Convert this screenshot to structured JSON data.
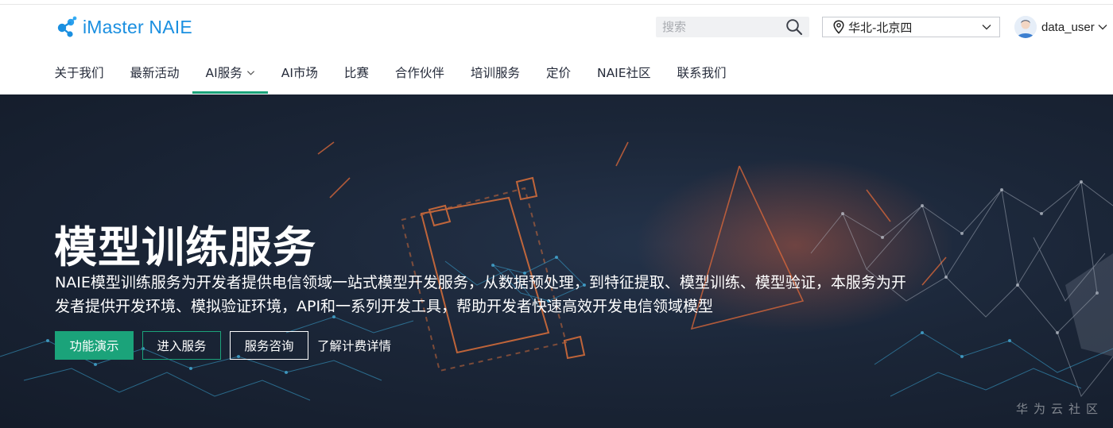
{
  "header": {
    "logo_text": "iMaster NAIE",
    "search": {
      "placeholder": "搜索"
    },
    "region": {
      "label": "华北-北京四"
    },
    "user": {
      "name": "data_user"
    }
  },
  "nav": {
    "items": [
      {
        "label": "关于我们"
      },
      {
        "label": "最新活动"
      },
      {
        "label": "AI服务",
        "active": true,
        "has_dropdown": true
      },
      {
        "label": "AI市场"
      },
      {
        "label": "比赛"
      },
      {
        "label": "合作伙伴"
      },
      {
        "label": "培训服务"
      },
      {
        "label": "定价"
      },
      {
        "label": "NAIE社区"
      },
      {
        "label": "联系我们"
      }
    ]
  },
  "hero": {
    "title": "模型训练服务",
    "description": "NAIE模型训练服务为开发者提供电信领域一站式模型开发服务，从数据预处理，到特征提取、模型训练、模型验证，本服务为开发者提供开发环境、模拟验证环境，API和一系列开发工具，帮助开发者快速高效开发电信领域模型",
    "buttons": {
      "demo": "功能演示",
      "enter": "进入服务",
      "consult": "服务咨询",
      "pricing_link": "了解计费详情"
    },
    "watermark": "华为云社区"
  },
  "colors": {
    "brand_blue": "#1a8fe0",
    "accent_green": "#1ba37a",
    "hero_bg": "#1b2638",
    "nav_text": "#252b3a"
  },
  "icons": {
    "logo": "naie-molecule-logo",
    "search": "search-icon",
    "region": "location-pin-icon",
    "dropdown": "chevron-down-icon",
    "avatar": "user-avatar-icon"
  }
}
